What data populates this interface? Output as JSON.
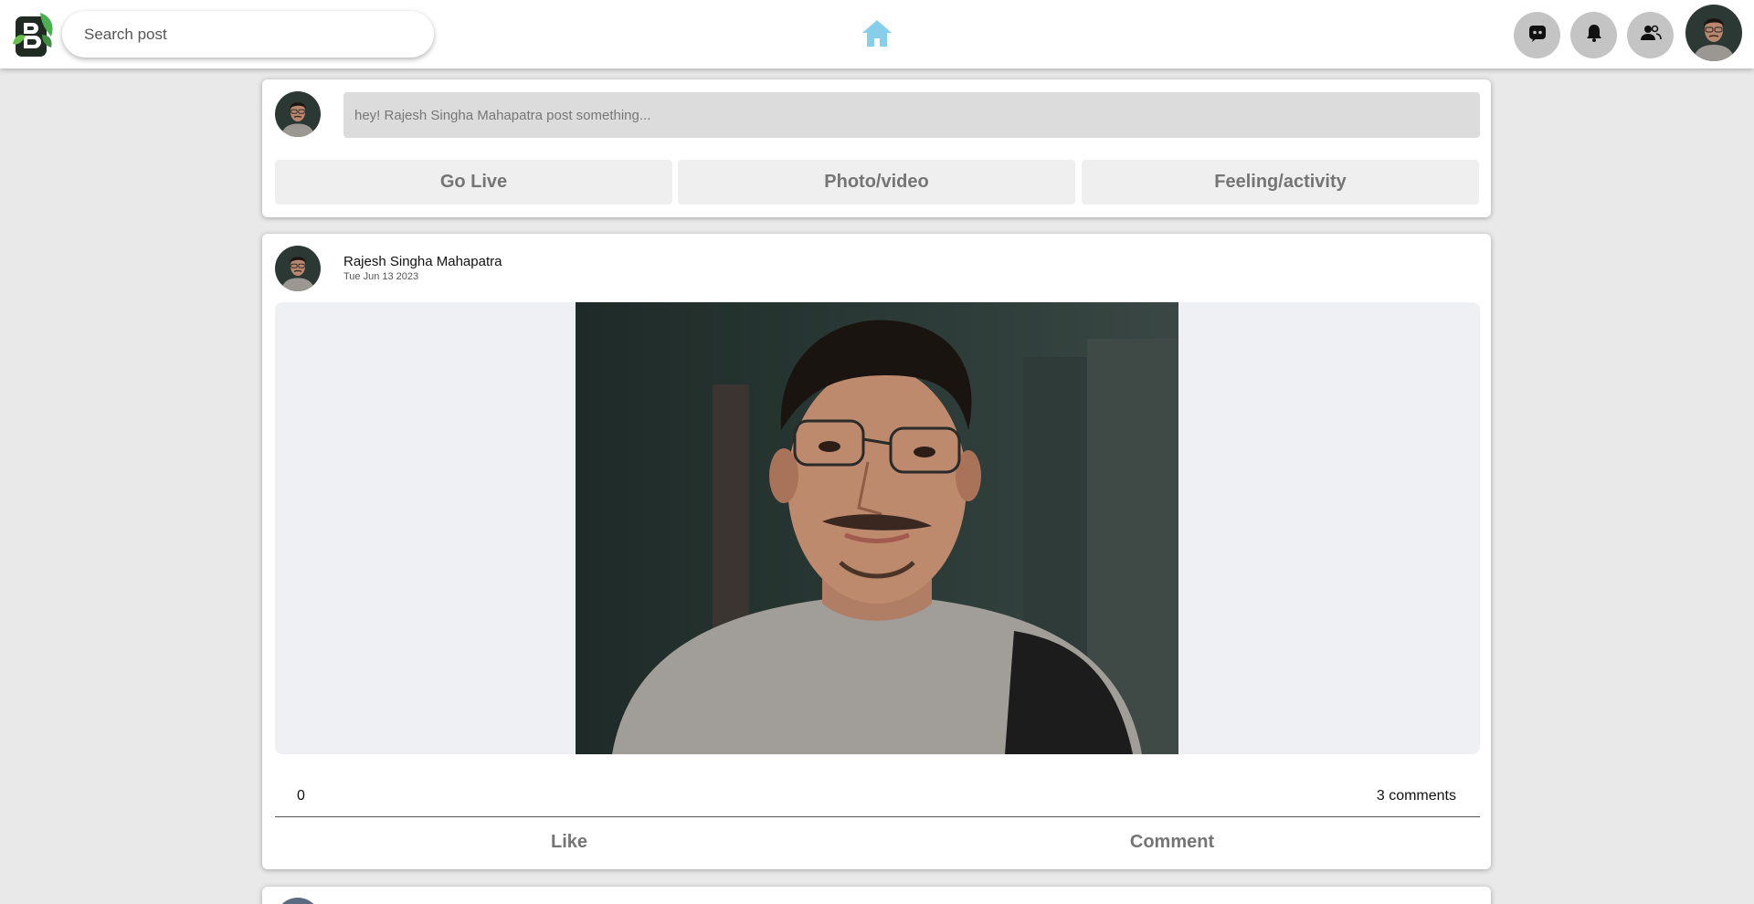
{
  "header": {
    "search": {
      "placeholder": "Search post"
    },
    "icons": {
      "logo": "app-logo",
      "home": "home-icon",
      "chat": "chat-icon",
      "notifications": "bell-icon",
      "friends": "users-icon"
    },
    "colors": {
      "home": "#87ceeb",
      "round_button": "#c4c4c4"
    }
  },
  "composer": {
    "placeholder": "hey! Rajesh Singha Mahapatra post something...",
    "actions": [
      {
        "label": "Go Live"
      },
      {
        "label": "Photo/video"
      },
      {
        "label": "Feeling/activity"
      }
    ]
  },
  "post": {
    "author": "Rajesh Singha Mahapatra",
    "date": "Tue Jun 13 2023",
    "likes_count": "0",
    "comments_count": "3 comments",
    "like_label": "Like",
    "comment_label": "Comment"
  }
}
